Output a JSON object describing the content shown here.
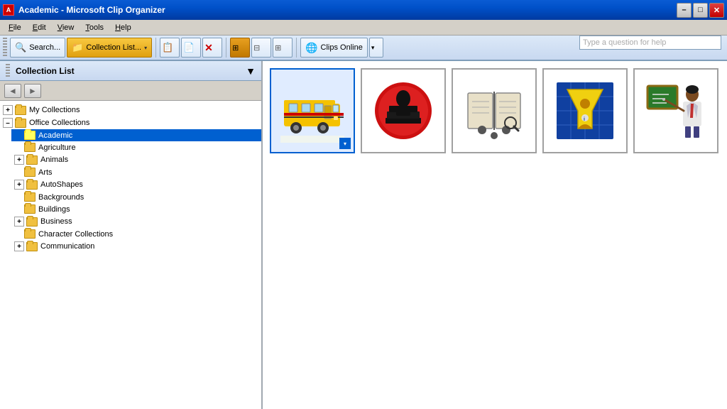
{
  "titleBar": {
    "icon": "A",
    "title": "Academic - Microsoft Clip Organizer",
    "minimize": "–",
    "maximize": "□",
    "close": "✕"
  },
  "menuBar": {
    "items": [
      {
        "label": "File",
        "underline": "F"
      },
      {
        "label": "Edit",
        "underline": "E"
      },
      {
        "label": "View",
        "underline": "V"
      },
      {
        "label": "Tools",
        "underline": "T"
      },
      {
        "label": "Help",
        "underline": "H"
      }
    ]
  },
  "helpBox": {
    "placeholder": "Type a question for help"
  },
  "toolbar": {
    "searchLabel": "Search...",
    "collectionListLabel": "Collection List...",
    "dropdownLabel": "▾",
    "clipsOnlineLabel": "Clips Online"
  },
  "collectionPanel": {
    "title": "Collection List",
    "backLabel": "◄",
    "forwardLabel": "►"
  },
  "tree": {
    "items": [
      {
        "id": "my-collections",
        "label": "My Collections",
        "indent": 0,
        "hasExpand": true,
        "expanded": false
      },
      {
        "id": "office-collections",
        "label": "Office Collections",
        "indent": 0,
        "hasExpand": true,
        "expanded": true
      },
      {
        "id": "academic",
        "label": "Academic",
        "indent": 2,
        "hasExpand": false,
        "selected": true
      },
      {
        "id": "agriculture",
        "label": "Agriculture",
        "indent": 2,
        "hasExpand": false
      },
      {
        "id": "animals",
        "label": "Animals",
        "indent": 2,
        "hasExpand": true,
        "expanded": false
      },
      {
        "id": "arts",
        "label": "Arts",
        "indent": 2,
        "hasExpand": false
      },
      {
        "id": "autoshapes",
        "label": "AutoShapes",
        "indent": 2,
        "hasExpand": true,
        "expanded": false
      },
      {
        "id": "backgrounds",
        "label": "Backgrounds",
        "indent": 2,
        "hasExpand": false
      },
      {
        "id": "buildings",
        "label": "Buildings",
        "indent": 2,
        "hasExpand": false
      },
      {
        "id": "business",
        "label": "Business",
        "indent": 2,
        "hasExpand": true,
        "expanded": false
      },
      {
        "id": "character-collections",
        "label": "Character Collections",
        "indent": 2,
        "hasExpand": false
      },
      {
        "id": "communication",
        "label": "Communication",
        "indent": 2,
        "hasExpand": true,
        "expanded": false
      }
    ]
  },
  "clipGrid": {
    "items": [
      {
        "id": "clip-bus",
        "selected": true,
        "hasDropdown": true
      },
      {
        "id": "clip-apple",
        "selected": false
      },
      {
        "id": "clip-book",
        "selected": false
      },
      {
        "id": "clip-filter",
        "selected": false
      },
      {
        "id": "clip-teacher",
        "selected": false
      }
    ]
  }
}
